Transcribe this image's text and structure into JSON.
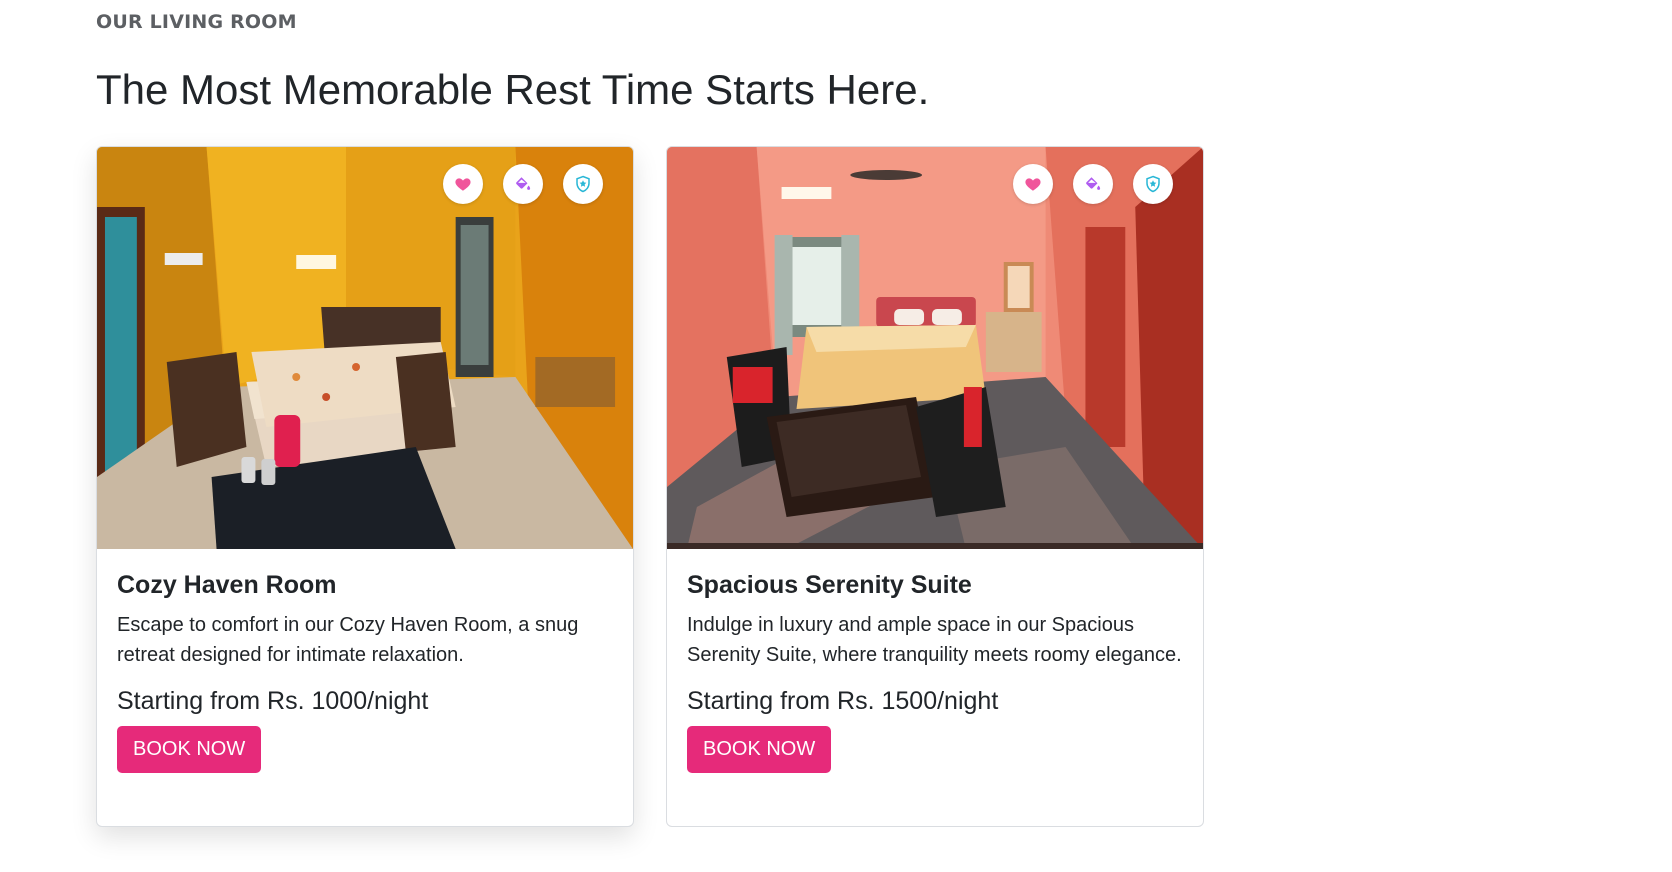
{
  "section": {
    "eyebrow": "OUR LIVING ROOM",
    "headline": "The Most Memorable Rest Time Starts Here."
  },
  "rooms": [
    {
      "title": "Cozy Haven Room",
      "description": "Escape to comfort in our Cozy Haven Room, a snug retreat designed for intimate relaxation.",
      "price": "Starting from Rs. 1000/night",
      "button": "BOOK NOW",
      "photo_theme": "yellow walls bedroom with floral bedspread",
      "badges": [
        "heart-icon",
        "paint-bucket-icon",
        "shield-icon"
      ]
    },
    {
      "title": "Spacious Serenity Suite",
      "description": "Indulge in luxury and ample space in our Spacious Serenity Suite, where tranquility meets roomy elegance.",
      "price": "Starting from Rs. 1500/night",
      "button": "BOOK NOW",
      "photo_theme": "peach walls suite with double bed and coffee table",
      "badges": [
        "heart-icon",
        "paint-bucket-icon",
        "shield-icon"
      ]
    }
  ],
  "colors": {
    "accent": "#e62a7a",
    "heart": "#f0559b",
    "paint": "#b05cf0",
    "shield": "#2ab7d6"
  }
}
